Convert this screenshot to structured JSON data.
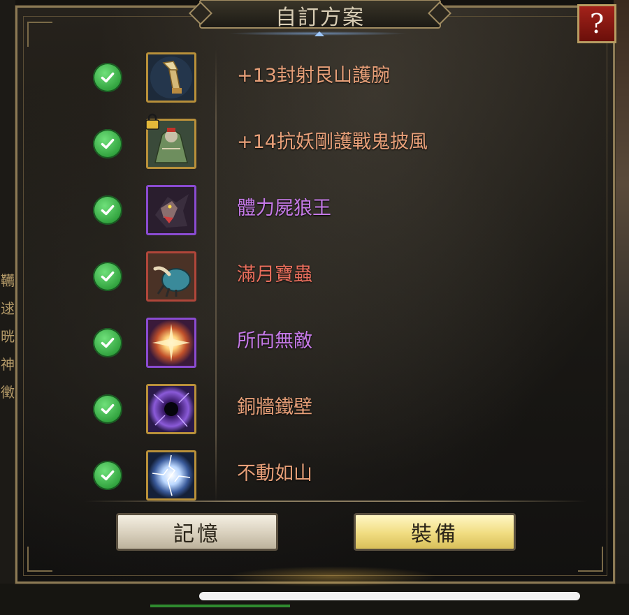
{
  "dialog": {
    "title": "自訂方案",
    "help_label": "?"
  },
  "items": [
    {
      "label": "+13封射艮山護腕",
      "color": "#e8a079",
      "icon": "bracer-icon",
      "frame": "gold",
      "locked": false,
      "checked": true
    },
    {
      "label": "+14抗妖剛護戰鬼披風",
      "color": "#e8a079",
      "icon": "cloak-icon",
      "frame": "gold",
      "locked": true,
      "checked": true
    },
    {
      "label": "體力屍狼王",
      "color": "#c67ae8",
      "icon": "wolf-icon",
      "frame": "purple",
      "locked": false,
      "checked": true
    },
    {
      "label": "滿月寶蟲",
      "color": "#e86e5c",
      "icon": "beetle-icon",
      "frame": "red",
      "locked": false,
      "checked": true
    },
    {
      "label": "所向無敵",
      "color": "#c67ae8",
      "icon": "burst-icon",
      "frame": "purple",
      "locked": false,
      "checked": true
    },
    {
      "label": "銅牆鐵壁",
      "color": "#e8a079",
      "icon": "vortex-icon",
      "frame": "gold",
      "locked": false,
      "checked": true
    },
    {
      "label": "不動如山",
      "color": "#e8a079",
      "icon": "lightning-orb-icon",
      "frame": "gold",
      "locked": false,
      "checked": true
    }
  ],
  "buttons": {
    "memory_label": "記憶",
    "equip_label": "裝備"
  },
  "background": {
    "side_chars": [
      "韉",
      "逑",
      "晄",
      "神",
      "徵"
    ]
  }
}
